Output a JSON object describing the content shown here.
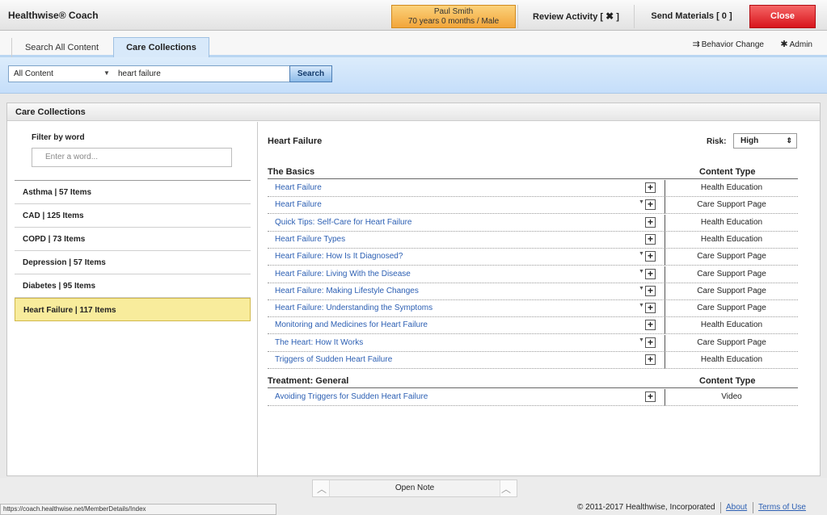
{
  "header": {
    "app_title": "Healthwise® Coach",
    "patient_name": "Paul Smith",
    "patient_details": "70 years 0 months / Male",
    "review_label": "Review Activity",
    "review_open": "[",
    "review_x": "✖",
    "review_close": "]",
    "send_label": "Send Materials",
    "send_count": "[ 0 ]",
    "close_label": "Close"
  },
  "tabs": [
    {
      "label": "Search All Content",
      "active": false
    },
    {
      "label": "Care Collections",
      "active": true
    }
  ],
  "toolbar": {
    "behavior_label": "Behavior Change",
    "admin_label": "Admin"
  },
  "search": {
    "scope": "All Content",
    "query": "heart failure",
    "button": "Search"
  },
  "panel": {
    "title": "Care Collections",
    "filter_label": "Filter by word",
    "filter_placeholder": "Enter a word...",
    "collections": [
      {
        "label": "Asthma | 57 Items",
        "active": false
      },
      {
        "label": "CAD | 125 Items",
        "active": false
      },
      {
        "label": "COPD | 73 Items",
        "active": false
      },
      {
        "label": "Depression | 57 Items",
        "active": false
      },
      {
        "label": "Diabetes | 95 Items",
        "active": false
      },
      {
        "label": "Heart Failure | 117 Items",
        "active": true
      }
    ]
  },
  "content": {
    "title": "Heart Failure",
    "risk_label": "Risk:",
    "risk_value": "High",
    "sections": [
      {
        "name": "The Basics",
        "type_header": "Content Type",
        "rows": [
          {
            "title": "Heart Failure",
            "dropdown": false,
            "type": "Health Education"
          },
          {
            "title": "Heart Failure",
            "dropdown": true,
            "type": "Care Support Page"
          },
          {
            "title": "Quick Tips: Self-Care for Heart Failure",
            "dropdown": false,
            "type": "Health Education"
          },
          {
            "title": "Heart Failure Types",
            "dropdown": false,
            "type": "Health Education"
          },
          {
            "title": "Heart Failure: How Is It Diagnosed?",
            "dropdown": true,
            "type": "Care Support Page"
          },
          {
            "title": "Heart Failure: Living With the Disease",
            "dropdown": true,
            "type": "Care Support Page"
          },
          {
            "title": "Heart Failure: Making Lifestyle Changes",
            "dropdown": true,
            "type": "Care Support Page"
          },
          {
            "title": "Heart Failure: Understanding the Symptoms",
            "dropdown": true,
            "type": "Care Support Page"
          },
          {
            "title": "Monitoring and Medicines for Heart Failure",
            "dropdown": false,
            "type": "Health Education"
          },
          {
            "title": "The Heart: How It Works",
            "dropdown": true,
            "type": "Care Support Page"
          },
          {
            "title": "Triggers of Sudden Heart Failure",
            "dropdown": false,
            "type": "Health Education"
          }
        ]
      },
      {
        "name": "Treatment: General",
        "type_header": "Content Type",
        "rows": [
          {
            "title": "Avoiding Triggers for Sudden Heart Failure",
            "dropdown": false,
            "type": "Video"
          }
        ]
      }
    ]
  },
  "footer": {
    "note_label": "Open Note",
    "status_url": "https://coach.healthwise.net/MemberDetails/Index",
    "copyright": "© 2011-2017 Healthwise, Incorporated",
    "about": "About",
    "terms": "Terms of Use"
  },
  "colors": {
    "accent_blue": "#c5defa",
    "link_blue": "#2c5fb3",
    "highlight_yellow": "#f8ec9c",
    "close_red": "#d8141c",
    "patient_orange": "#f2a53a"
  },
  "icons": {
    "behavior": "behavior-change-icon",
    "admin": "gear-icon",
    "plus": "plus-box-icon",
    "dropdown": "dropdown-arrow-icon"
  }
}
